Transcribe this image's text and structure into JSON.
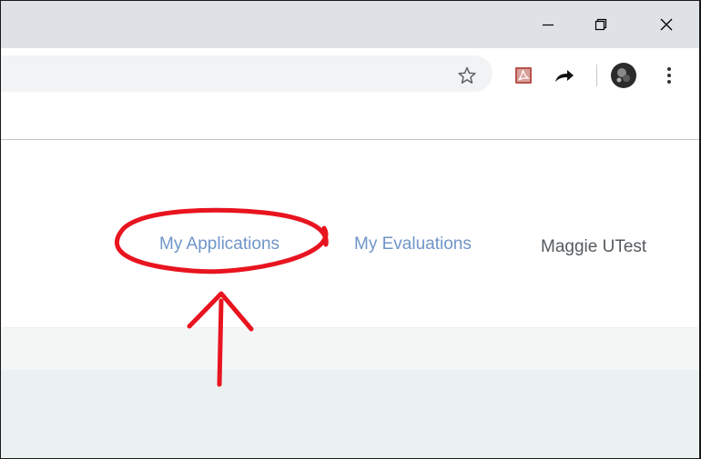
{
  "window": {
    "controls": {
      "minimize_icon": "minimize-icon",
      "restore_icon": "restore-icon",
      "close_icon": "close-icon"
    }
  },
  "toolbar": {
    "icons": [
      "star-icon",
      "pdf-extension-icon",
      "share-arrow-icon",
      "profile-avatar",
      "menu-dots-icon"
    ]
  },
  "nav": {
    "my_applications": "My Applications",
    "my_evaluations": "My Evaluations",
    "user_name": "Maggie UTest"
  },
  "colors": {
    "link": "#6f95c8",
    "annotation": "#e8141f",
    "titlebar": "#dee1e6",
    "omnibox": "#f1f3f4"
  },
  "annotation": {
    "type": "hand-drawn ellipse and arrow",
    "target": "my_applications"
  }
}
